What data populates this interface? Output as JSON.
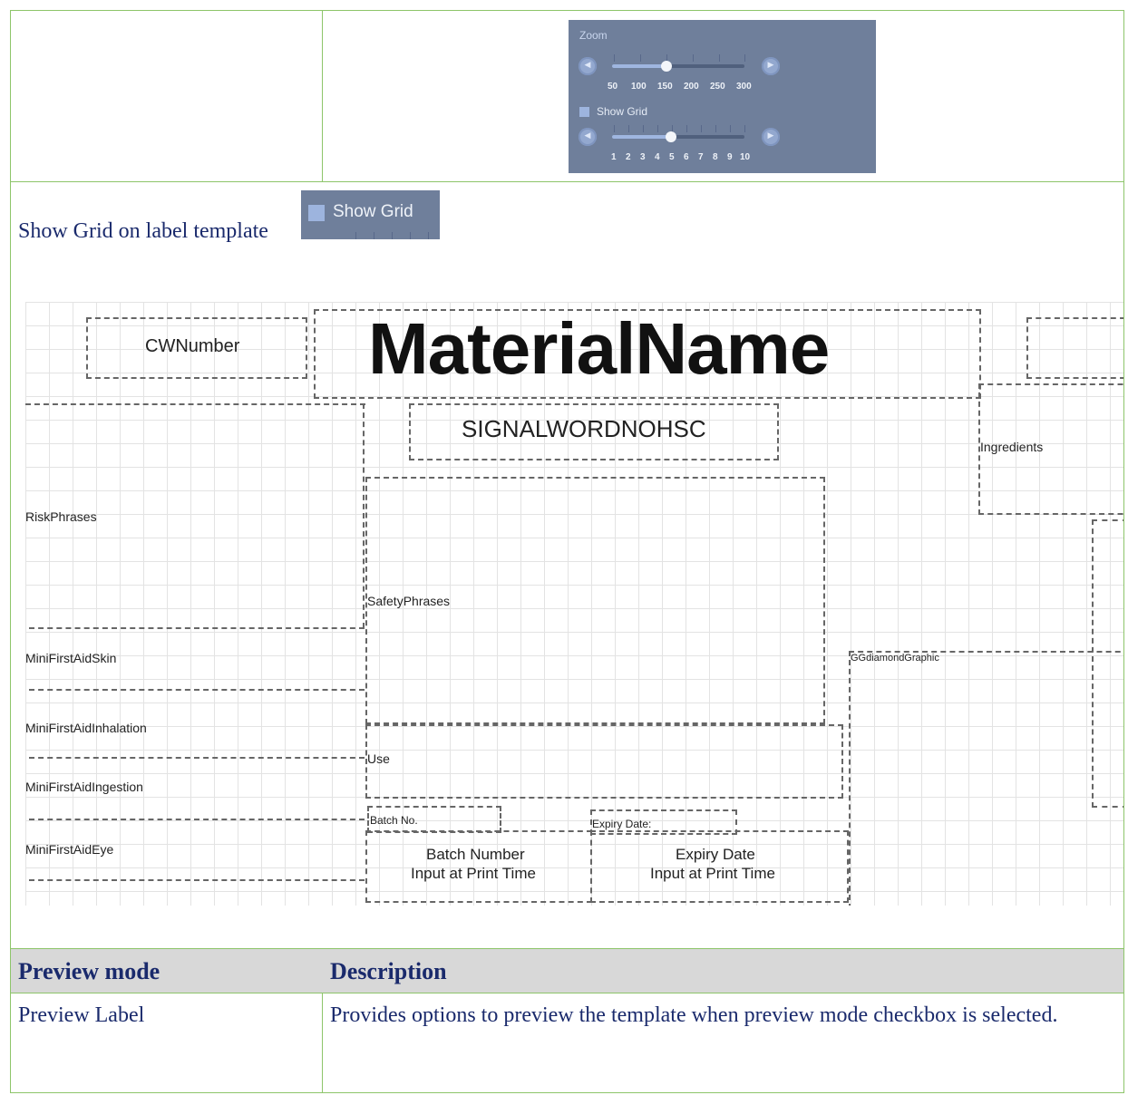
{
  "zoom_panel": {
    "title": "Zoom",
    "zoom_ticks": [
      "50",
      "100",
      "150",
      "200",
      "250",
      "300"
    ],
    "zoom_value": 150,
    "show_grid_label": "Show Grid",
    "grid_ticks": [
      "1",
      "2",
      "3",
      "4",
      "5",
      "6",
      "7",
      "8",
      "9",
      "10"
    ],
    "grid_value": 5
  },
  "show_grid_section": {
    "caption": "Show Grid on label template",
    "badge_label": "Show Grid"
  },
  "label_template": {
    "cw_number": "CWNumber",
    "material_name": "MaterialName",
    "signal_word": "SIGNALWORDNOHSC",
    "ingredients": "Ingredients",
    "risk_phrases": "RiskPhrases",
    "safety_phrases": "SafetyPhrases",
    "mini_first_aid_skin": "MiniFirstAidSkin",
    "mini_first_aid_inhalation": "MiniFirstAidInhalation",
    "mini_first_aid_ingestion": "MiniFirstAidIngestion",
    "mini_first_aid_eye": "MiniFirstAidEye",
    "diamond_graphic": "GGdiamondGraphic",
    "use": "Use",
    "batch_no_label": "Batch No.",
    "expiry_date_label": "Expiry Date:",
    "batch_number_line1": "Batch Number",
    "batch_number_line2": "Input at Print Time",
    "expiry_date_line1": "Expiry Date",
    "expiry_date_line2": "Input at Print Time"
  },
  "table": {
    "headers": [
      "Preview mode",
      "Description"
    ],
    "rows": [
      [
        "Preview Label",
        "Provides options to preview the template when preview mode checkbox is selected."
      ]
    ]
  },
  "colors": {
    "border": "#8dc56a",
    "text": "#1a2a6c",
    "header_bg": "#d8d8d8",
    "panel_bg": "#6f7f9b"
  }
}
